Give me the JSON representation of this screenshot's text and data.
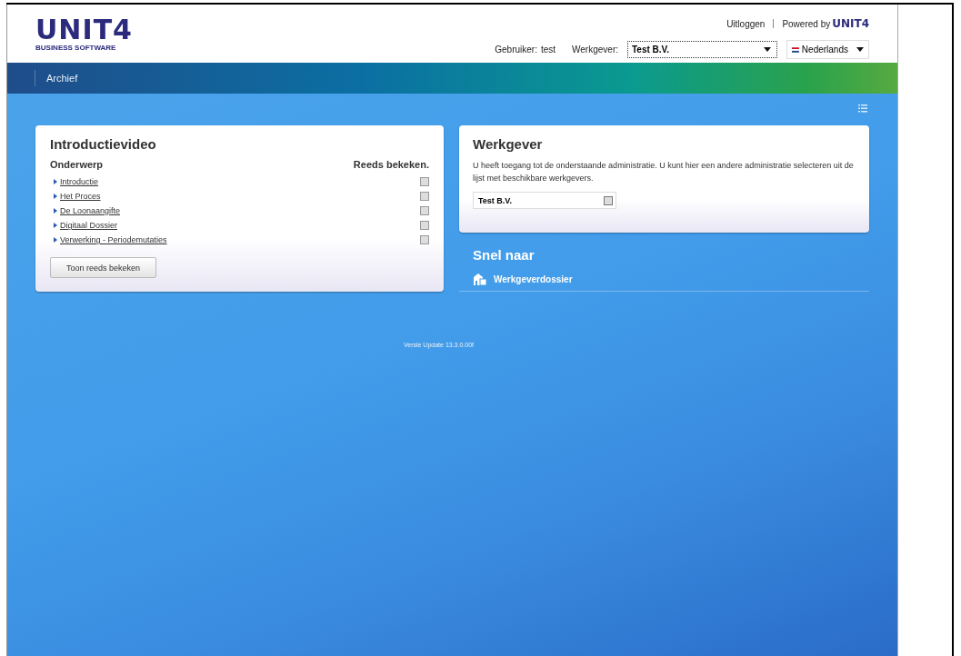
{
  "header": {
    "logo": "UNIT4",
    "logo_sub": "BUSINESS SOFTWARE",
    "logout": "Uitloggen",
    "powered_by": "Powered by",
    "powered_logo": "UNIT4",
    "user_label": "Gebruiker:",
    "user": "test",
    "employer_label": "Werkgever:",
    "employer": "Test B.V.",
    "language": "Nederlands"
  },
  "nav": {
    "items": [
      {
        "label": "Archief",
        "selected": false
      }
    ]
  },
  "intro": {
    "title": "Introductievideo",
    "col_subject": "Onderwerp",
    "col_seen": "Reeds bekeken.",
    "videos": [
      {
        "label": "Introductie",
        "checked": false
      },
      {
        "label": "Het Proces",
        "checked": false
      },
      {
        "label": "De Loonaangifte",
        "checked": false
      },
      {
        "label": "Digitaal Dossier",
        "checked": false
      },
      {
        "label": "Verwerking - Periodemutaties",
        "checked": false
      }
    ],
    "button": "Toon reeds bekeken"
  },
  "employer_card": {
    "title": "Werkgever",
    "text": "U heeft toegang tot de onderstaande administratie. U kunt hier een andere administratie selecteren uit de lijst met beschikbare werkgevers.",
    "select": "Test B.V."
  },
  "quick": {
    "title": "Snel naar",
    "links": [
      "Werkgeverdossier"
    ]
  },
  "version": "Versie Update 13.3.0.00f"
}
